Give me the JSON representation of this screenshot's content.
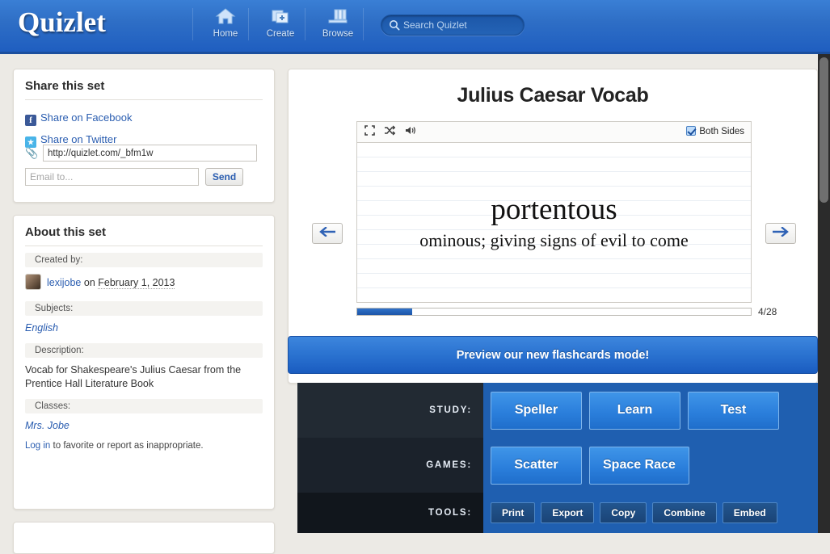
{
  "header": {
    "logo": "Quizlet",
    "nav": [
      {
        "label": "Home",
        "icon": "home-icon"
      },
      {
        "label": "Create",
        "icon": "create-icon"
      },
      {
        "label": "Browse",
        "icon": "browse-icon"
      }
    ],
    "search": {
      "placeholder": "Search Quizlet",
      "value": "",
      "icon": "search-icon"
    }
  },
  "share_panel": {
    "title": "Share this set",
    "facebook_label": "Share on Facebook",
    "facebook_icon": "facebook-icon",
    "twitter_label": "Share on Twitter",
    "twitter_icon": "twitter-icon",
    "link_icon": "paperclip-icon",
    "url_value": "http://quizlet.com/_bfm1w",
    "email_placeholder": "Email to...",
    "email_value": "",
    "send_label": "Send"
  },
  "about_panel": {
    "title": "About this set",
    "created_label": "Created by:",
    "author": "lexijobe",
    "on_word": " on ",
    "created_date": "February 1, 2013",
    "subjects_label": "Subjects:",
    "subjects_value": "English",
    "description_label": "Description:",
    "description_value": "Vocab for Shakespeare's Julius Caesar from the Prentice Hall Literature Book",
    "classes_label": "Classes:",
    "classes_value": "Mrs. Jobe",
    "login_link": "Log in",
    "login_rest": " to favorite or report as inappropriate."
  },
  "set": {
    "title": "Julius Caesar Vocab",
    "toolbar": {
      "fullscreen_icon": "fullscreen-icon",
      "shuffle_icon": "shuffle-icon",
      "audio_icon": "speaker-icon",
      "both_sides_label": "Both Sides",
      "both_sides_checked": true
    },
    "card": {
      "term": "portentous",
      "definition": "ominous; giving signs of evil to come"
    },
    "progress": {
      "current": 4,
      "total": 28,
      "label": "4/28",
      "percent": 14
    },
    "prev_arrow_icon": "arrow-left-icon",
    "next_arrow_icon": "arrow-right-icon"
  },
  "preview_banner": {
    "label": "Preview our new flashcards mode!"
  },
  "modes": {
    "study": {
      "label": "STUDY:",
      "buttons": [
        "Speller",
        "Learn",
        "Test"
      ]
    },
    "games": {
      "label": "GAMES:",
      "buttons": [
        "Scatter",
        "Space Race"
      ]
    },
    "tools": {
      "label": "TOOLS:",
      "buttons": [
        "Print",
        "Export",
        "Copy",
        "Combine",
        "Embed"
      ]
    }
  },
  "colors": {
    "brand_blue": "#1f5ec0",
    "link_blue": "#2a5db0",
    "button_blue": "#2b7fdc",
    "dark_panel": "#1b222b",
    "page_bg": "#eceae5"
  }
}
